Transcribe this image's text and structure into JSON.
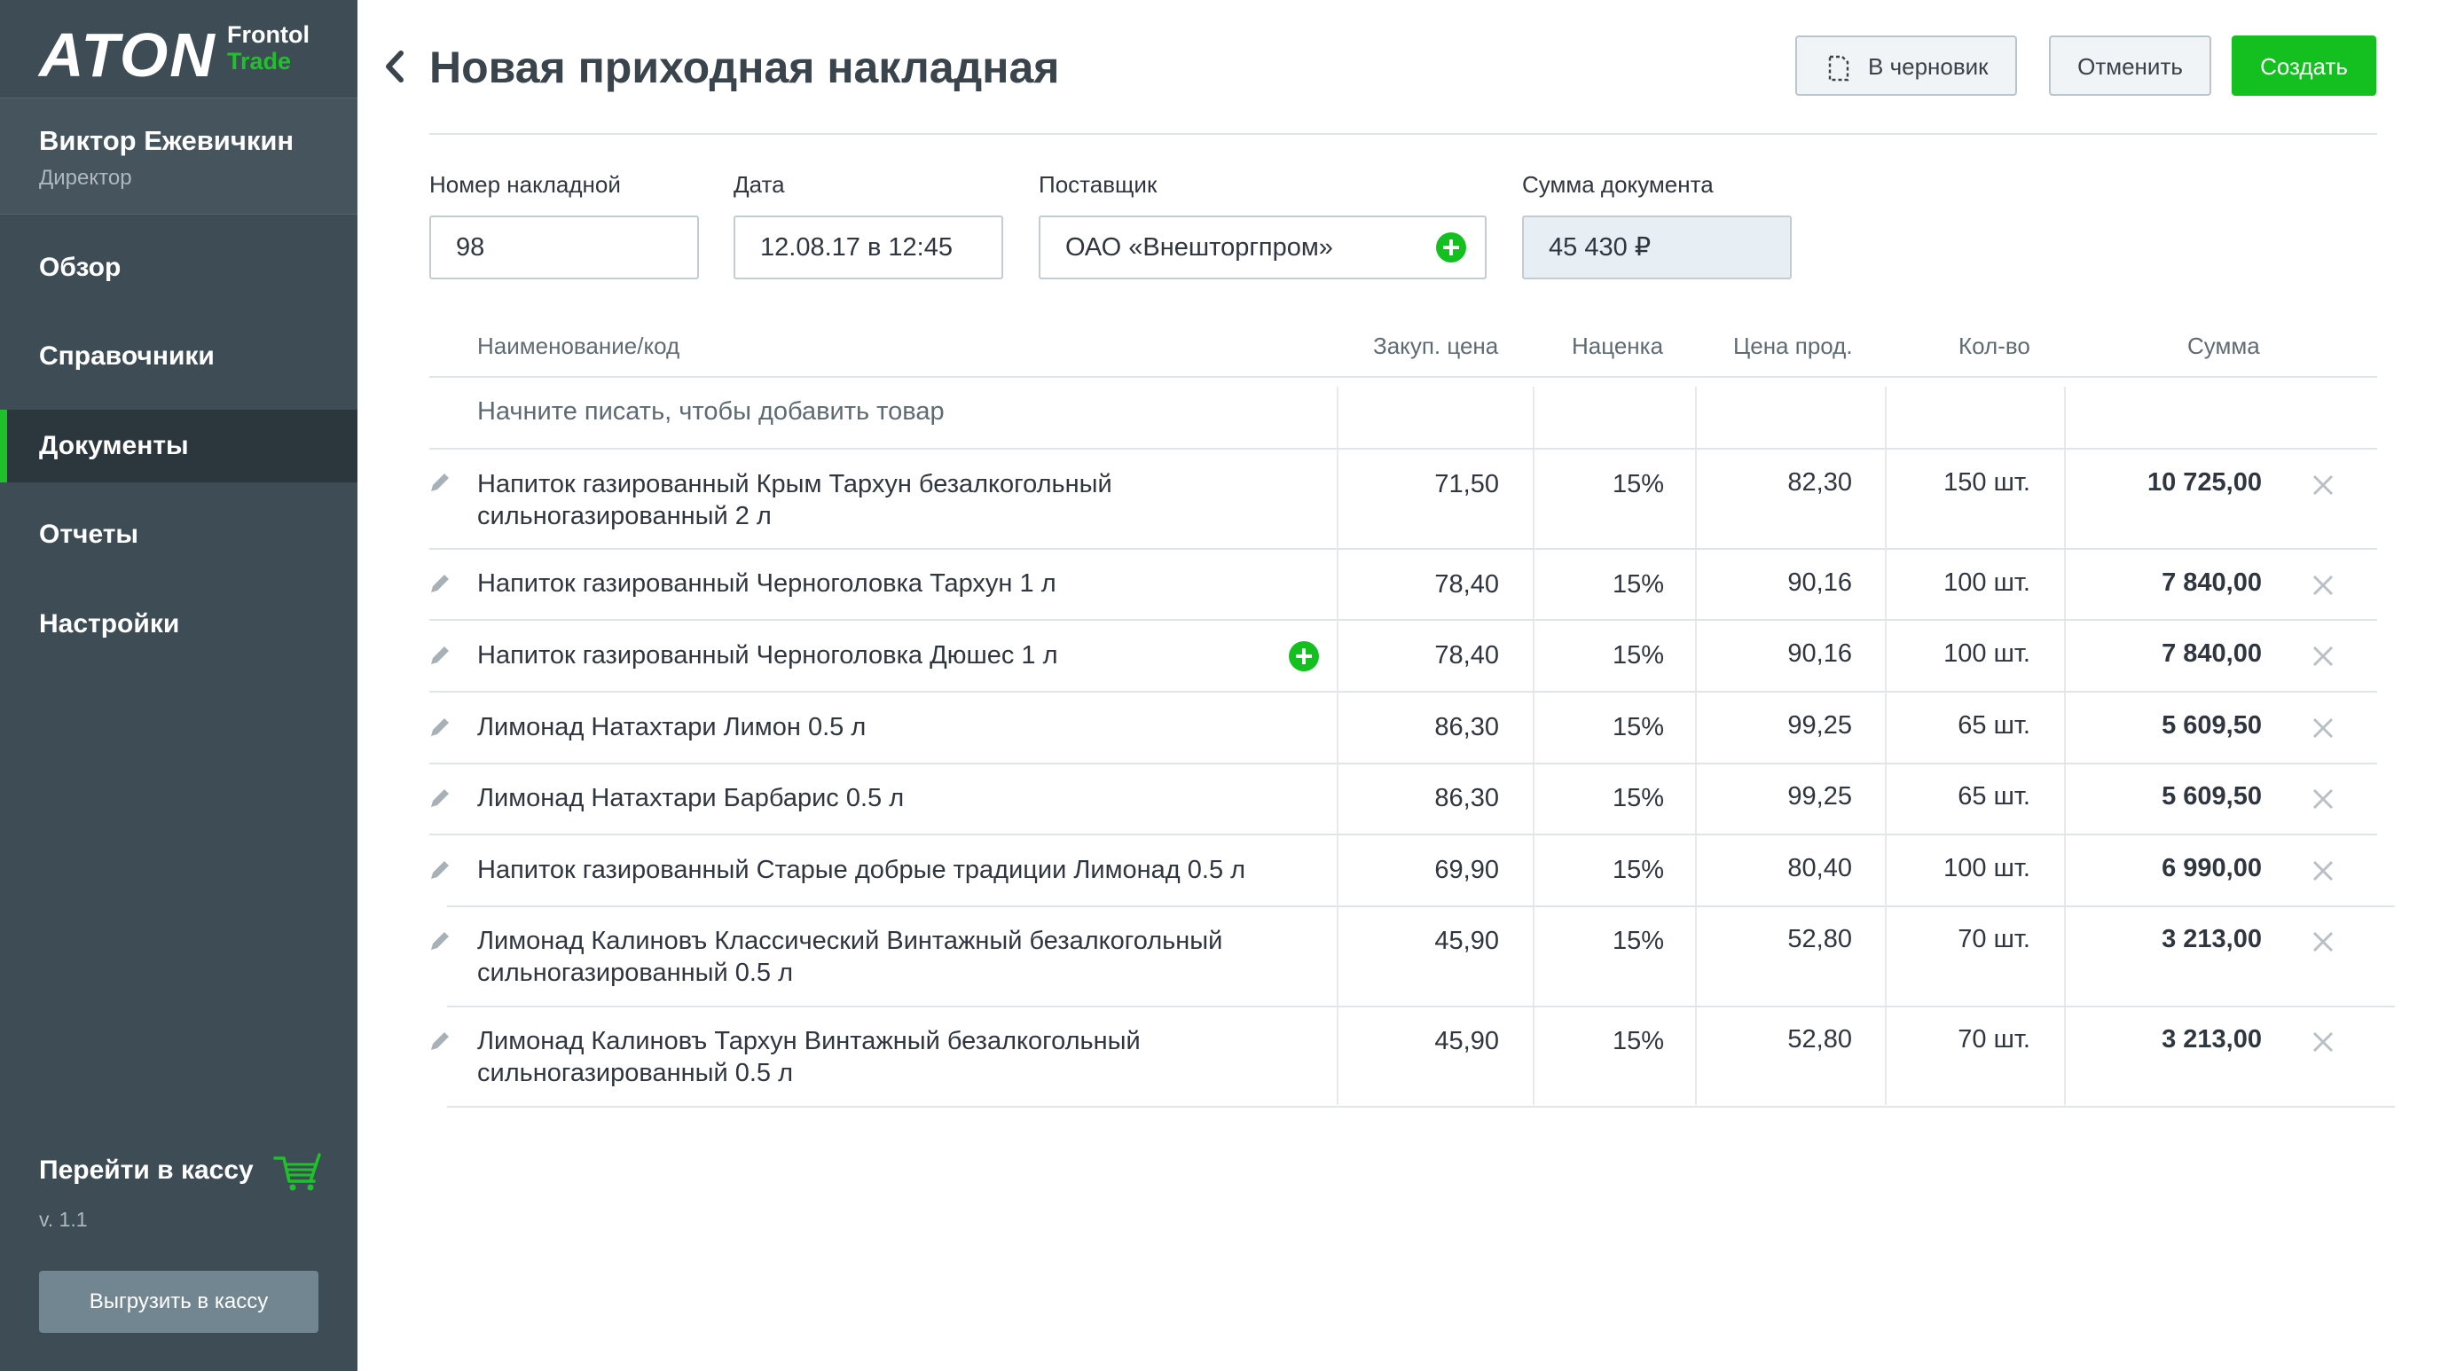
{
  "brand": {
    "logo_text": "ATON",
    "product_line1": "Frontol",
    "product_line2": "Trade",
    "accent": "#13c01f"
  },
  "user": {
    "name": "Виктор Ежевичкин",
    "role": "Директор"
  },
  "nav": {
    "items": [
      {
        "label": "Обзор"
      },
      {
        "label": "Справочники"
      },
      {
        "label": "Документы",
        "active": true
      },
      {
        "label": "Отчеты"
      },
      {
        "label": "Настройки"
      }
    ]
  },
  "footer": {
    "cash_link": "Перейти в кассу",
    "version": "v. 1.1",
    "export_button": "Выгрузить в кассу"
  },
  "header": {
    "title": "Новая приходная накладная",
    "draft_button": "В черновик",
    "cancel_button": "Отменить",
    "create_button": "Создать"
  },
  "form": {
    "number_label": "Номер накладной",
    "number_value": "98",
    "date_label": "Дата",
    "date_value": "12.08.17 в 12:45",
    "supplier_label": "Поставщик",
    "supplier_value": "ОАО «Внешторгпром»",
    "sum_label": "Сумма документа",
    "sum_value": "45 430 ₽"
  },
  "table": {
    "columns": [
      "Наименование/код",
      "Закуп. цена",
      "Наценка",
      "Цена прод.",
      "Кол-во",
      "Сумма"
    ],
    "add_placeholder": "Начните писать, чтобы добавить товар",
    "rows": [
      {
        "name": "Напиток газированный Крым Тархун безалкогольный сильногазированный 2 л",
        "purchase": "71,50",
        "markup": "15%",
        "sale": "82,30",
        "qty": "150 шт.",
        "sum": "10 725,00"
      },
      {
        "name": "Напиток газированный Черноголовка Тархун 1 л",
        "purchase": "78,40",
        "markup": "15%",
        "sale": "90,16",
        "qty": "100 шт.",
        "sum": "7 840,00"
      },
      {
        "name": "Напиток газированный Черноголовка Дюшес 1 л",
        "purchase": "78,40",
        "markup": "15%",
        "sale": "90,16",
        "qty": "100 шт.",
        "sum": "7 840,00"
      },
      {
        "name": "Лимонад Натахтари Лимон 0.5 л",
        "purchase": "86,30",
        "markup": "15%",
        "sale": "99,25",
        "qty": "65 шт.",
        "sum": "5 609,50"
      },
      {
        "name": "Лимонад Натахтари Барбарис 0.5 л",
        "purchase": "86,30",
        "markup": "15%",
        "sale": "99,25",
        "qty": "65 шт.",
        "sum": "5 609,50"
      },
      {
        "name": "Напиток газированный Старые добрые традиции Лимонад 0.5 л",
        "purchase": "69,90",
        "markup": "15%",
        "sale": "80,40",
        "qty": "100 шт.",
        "sum": "6 990,00"
      },
      {
        "name": "Лимонад Калиновъ Классический Винтажный безалкогольный сильногазированный 0.5 л",
        "purchase": "45,90",
        "markup": "15%",
        "sale": "52,80",
        "qty": "70 шт.",
        "sum": "3 213,00"
      },
      {
        "name": "Лимонад Калиновъ Тархун Винтажный безалкогольный сильногазированный 0.5 л",
        "purchase": "45,90",
        "markup": "15%",
        "sale": "52,80",
        "qty": "70 шт.",
        "sum": "3 213,00"
      }
    ]
  }
}
